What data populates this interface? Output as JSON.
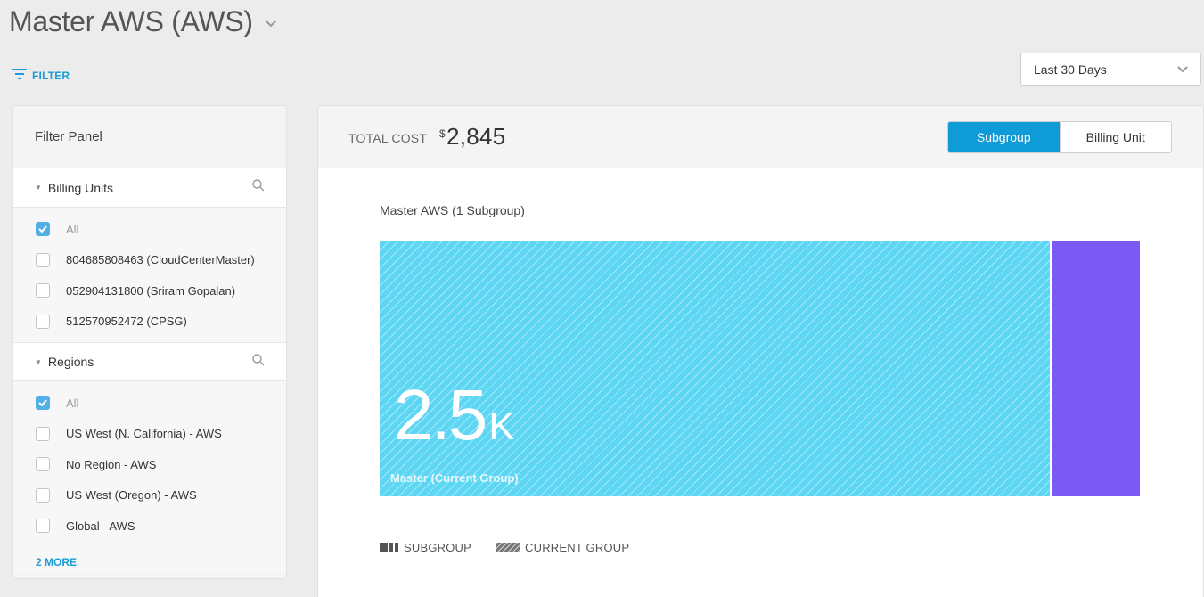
{
  "header": {
    "title": "Master AWS (AWS)"
  },
  "filter_link": {
    "label": "FILTER"
  },
  "date_range": {
    "selected": "Last 30 Days"
  },
  "filter_panel": {
    "title": "Filter Panel",
    "billing_units": {
      "label": "Billing Units",
      "items": [
        {
          "label": "All",
          "checked": true
        },
        {
          "label": "804685808463 (CloudCenterMaster)",
          "checked": false
        },
        {
          "label": "052904131800 (Sriram Gopalan)",
          "checked": false
        },
        {
          "label": "512570952472 (CPSG)",
          "checked": false
        }
      ]
    },
    "regions": {
      "label": "Regions",
      "items": [
        {
          "label": "All",
          "checked": true
        },
        {
          "label": "US West (N. California) - AWS",
          "checked": false
        },
        {
          "label": "No Region - AWS",
          "checked": false
        },
        {
          "label": "US West (Oregon) - AWS",
          "checked": false
        },
        {
          "label": "Global - AWS",
          "checked": false
        }
      ]
    },
    "more_label": "2 MORE"
  },
  "summary": {
    "total_cost_label": "TOTAL COST",
    "currency": "$",
    "total_cost_value": "2,845",
    "toggle": {
      "subgroup": "Subgroup",
      "billing_unit": "Billing Unit",
      "active": "Subgroup"
    }
  },
  "chart": {
    "title": "Master AWS (1 Subgroup)",
    "main_value": "2.5",
    "main_unit": "K",
    "main_caption": "Master (Current Group)",
    "legend": {
      "subgroup": "SUBGROUP",
      "current_group": "CURRENT GROUP"
    },
    "colors": {
      "current_group": "#5dd6f4",
      "subgroup": "#7b5af3",
      "accent": "#0f9bd7"
    }
  }
}
